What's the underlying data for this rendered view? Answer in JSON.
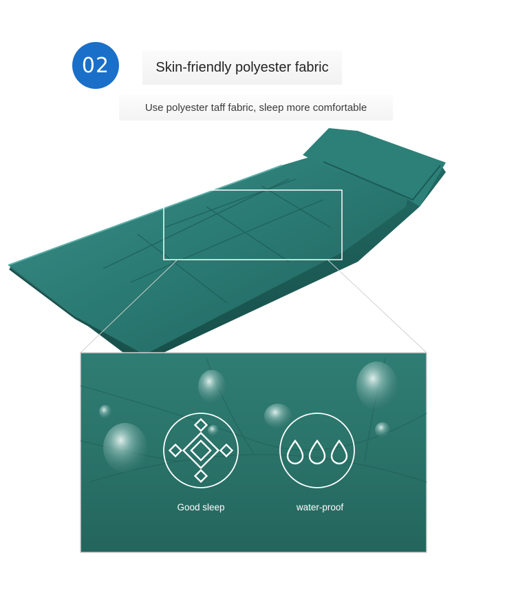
{
  "section_number": "02",
  "title": "Skin-friendly polyester fabric",
  "subtitle": "Use polyester taff fabric, sleep more comfortable",
  "features": [
    {
      "label": "Good sleep",
      "icon": "sleep-knot-icon"
    },
    {
      "label": "water-proof",
      "icon": "water-drops-icon"
    }
  ],
  "colors": {
    "badge": "#1a6fc8",
    "fabric": "#2e7f78",
    "fabric_dark": "#1c5550"
  }
}
